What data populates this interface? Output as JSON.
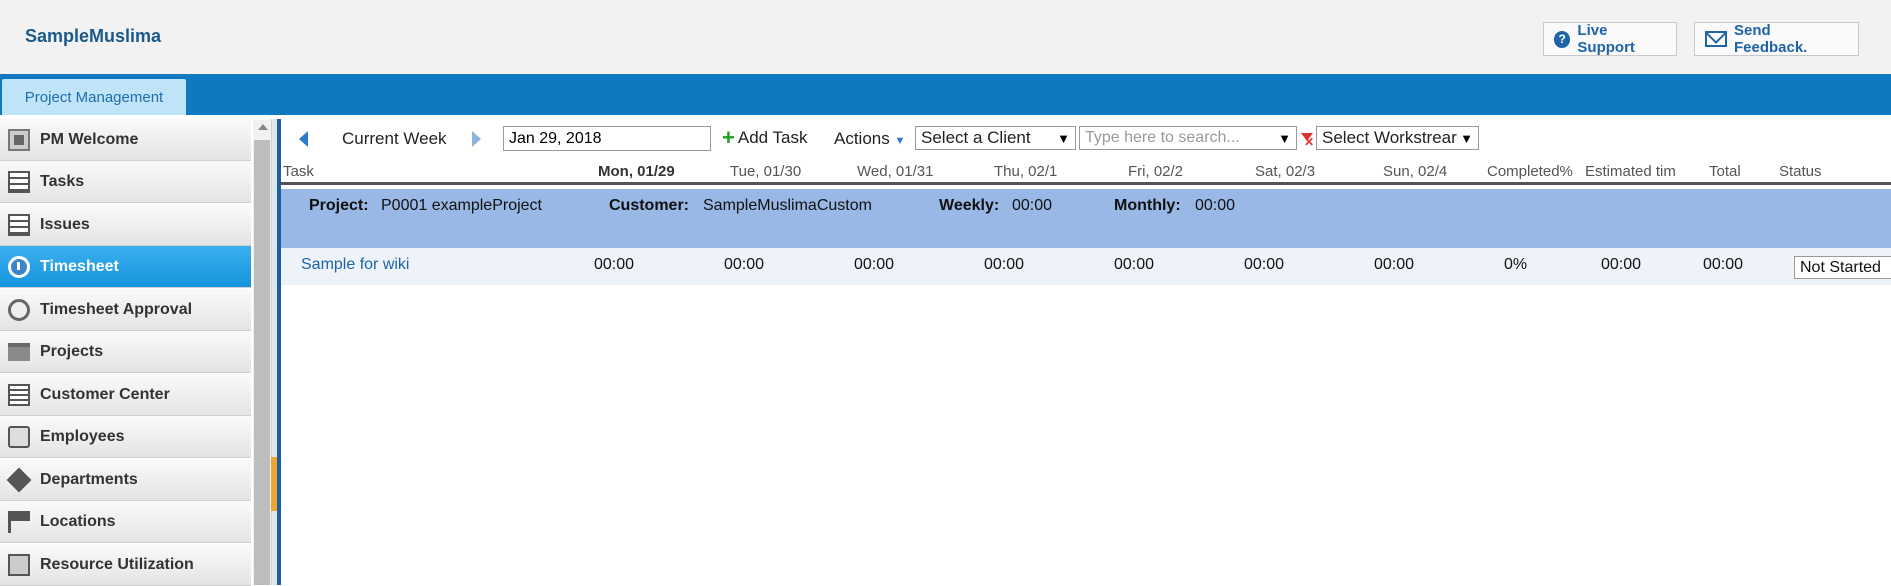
{
  "app": {
    "title": "SampleMuslima"
  },
  "header": {
    "live_support": "Live Support",
    "send_feedback": "Send Feedback."
  },
  "tabs": [
    {
      "label": "Project Management"
    }
  ],
  "sidebar": {
    "items": [
      {
        "label": "PM Welcome",
        "icon": "grid-icon"
      },
      {
        "label": "Tasks",
        "icon": "list-icon"
      },
      {
        "label": "Issues",
        "icon": "list-icon"
      },
      {
        "label": "Timesheet",
        "icon": "clock-icon",
        "active": true
      },
      {
        "label": "Timesheet Approval",
        "icon": "check-icon"
      },
      {
        "label": "Projects",
        "icon": "folder-icon"
      },
      {
        "label": "Customer Center",
        "icon": "document-icon"
      },
      {
        "label": "Employees",
        "icon": "person-icon"
      },
      {
        "label": "Departments",
        "icon": "cube-icon"
      },
      {
        "label": "Locations",
        "icon": "flag-icon"
      },
      {
        "label": "Resource Utilization",
        "icon": "people-icon"
      }
    ]
  },
  "toolbar": {
    "current_week": "Current Week",
    "date_value": "Jan 29, 2018",
    "add_task": "Add Task",
    "actions": "Actions",
    "client_select": "Select a Client",
    "search_placeholder": "Type here to search...",
    "workstream_select": "Select Workstrear"
  },
  "columns": {
    "task": "Task",
    "mon": "Mon, 01/29",
    "tue": "Tue, 01/30",
    "wed": "Wed, 01/31",
    "thu": "Thu, 02/1",
    "fri": "Fri, 02/2",
    "sat": "Sat, 02/3",
    "sun": "Sun, 02/4",
    "completed": "Completed%",
    "estimated": "Estimated tim",
    "total": "Total",
    "status": "Status"
  },
  "project": {
    "project_label": "Project:",
    "project_value": "P0001 exampleProject",
    "customer_label": "Customer:",
    "customer_value": "SampleMuslimaCustom",
    "weekly_label": "Weekly:",
    "weekly_value": "00:00",
    "monthly_label": "Monthly:",
    "monthly_value": "00:00"
  },
  "rows": [
    {
      "task": "Sample for wiki",
      "mon": "00:00",
      "tue": "00:00",
      "wed": "00:00",
      "thu": "00:00",
      "fri": "00:00",
      "sat": "00:00",
      "sun": "00:00",
      "completed": "0%",
      "estimated": "00:00",
      "total": "00:00",
      "status": "Not Started"
    }
  ]
}
